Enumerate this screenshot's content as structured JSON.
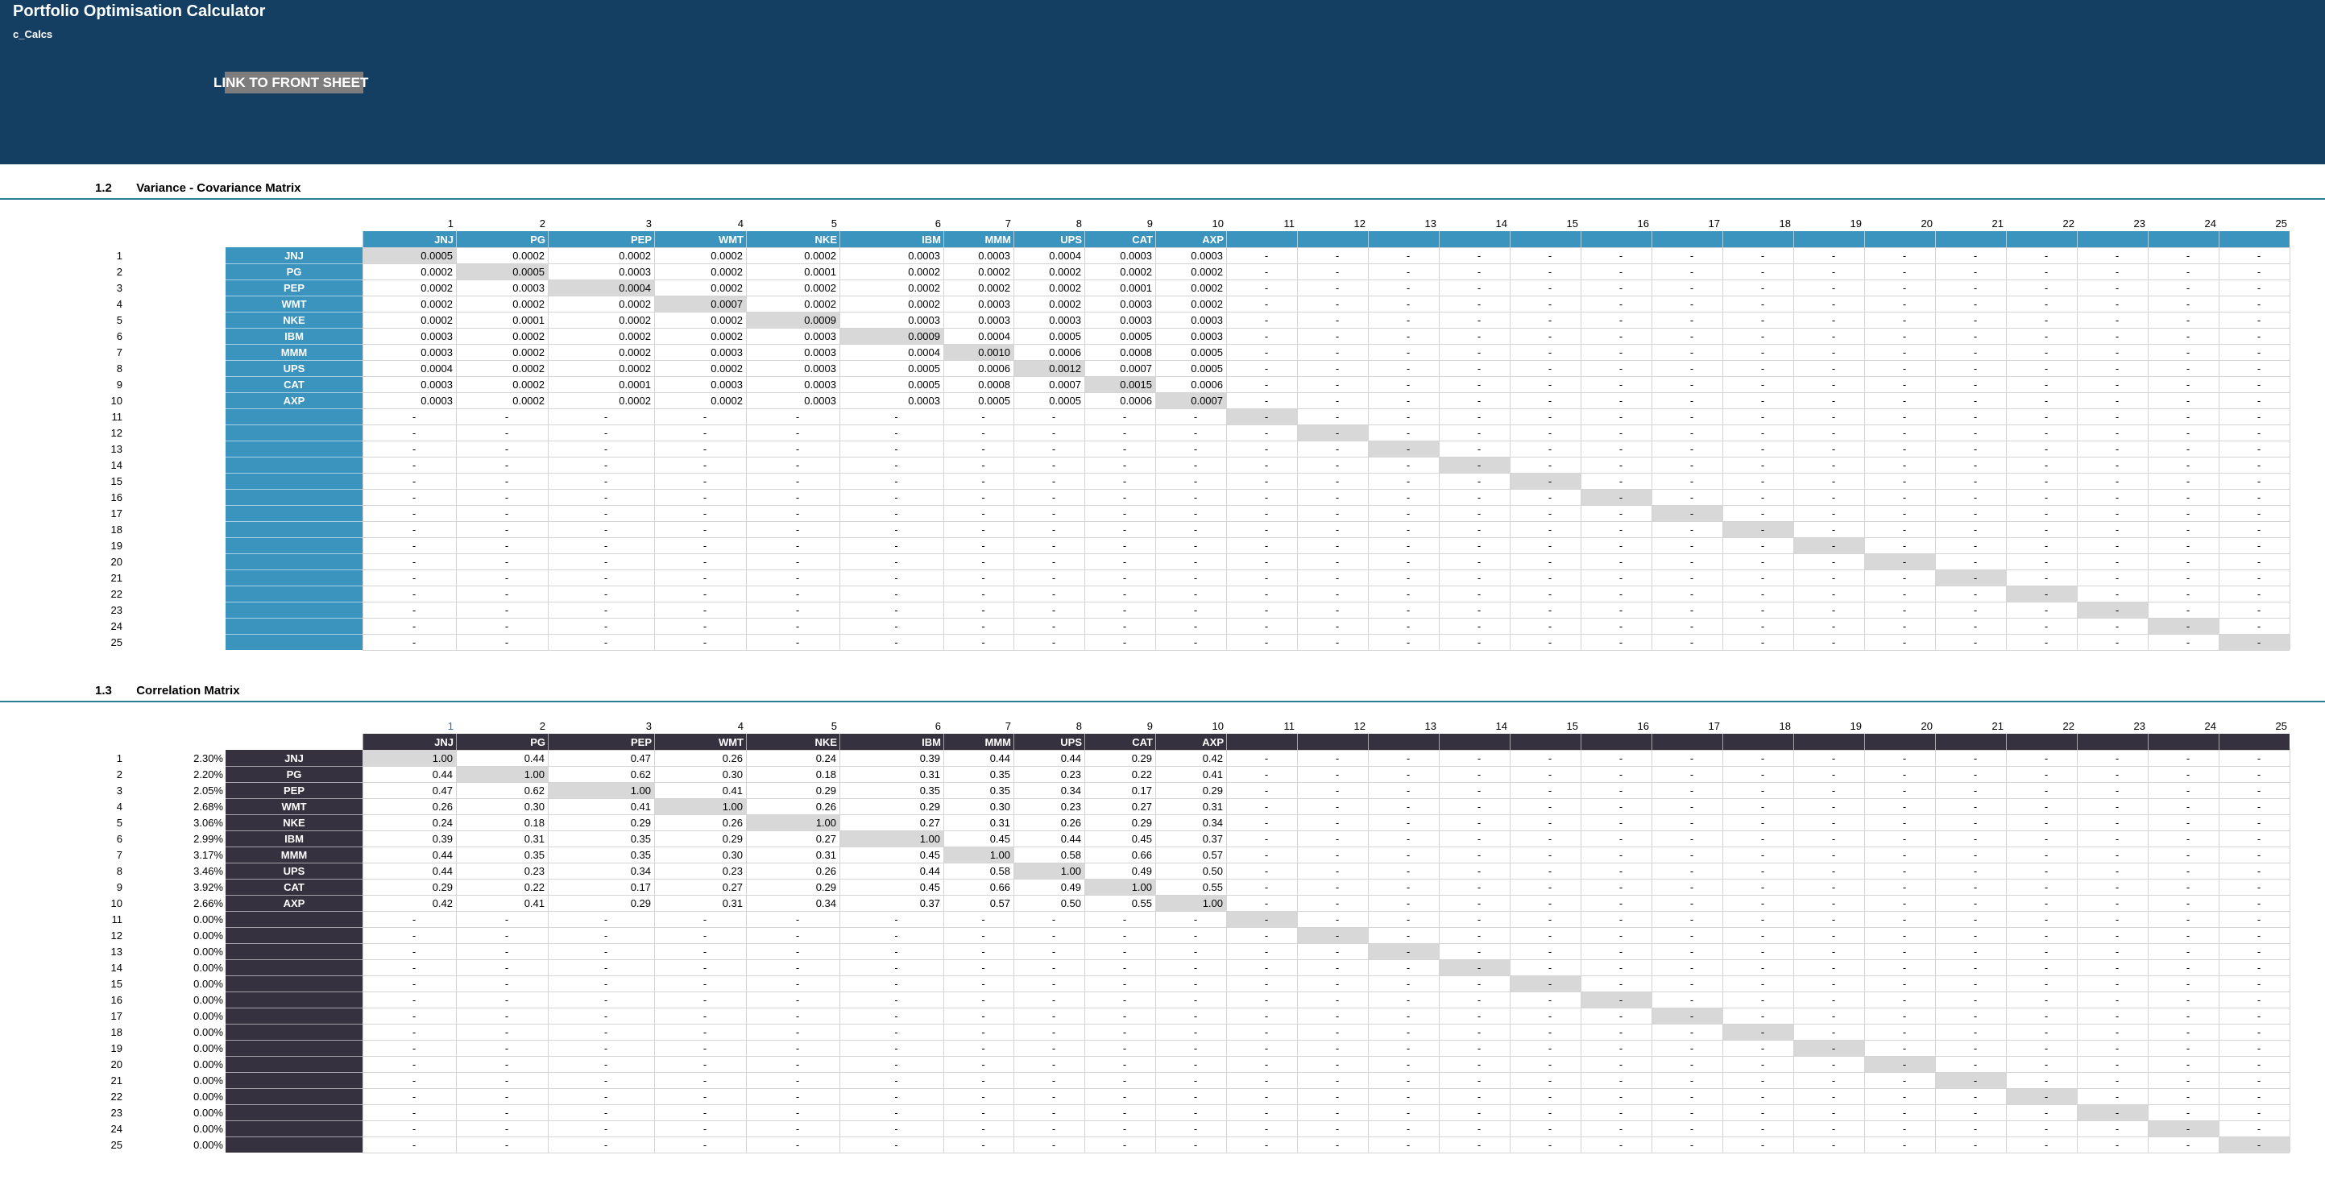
{
  "header": {
    "title": "Portfolio Optimisation Calculator",
    "sheet_name": "c_Calcs",
    "link_label": "LINK TO FRONT SHEET"
  },
  "tickers": [
    "JNJ",
    "PG",
    "PEP",
    "WMT",
    "NKE",
    "IBM",
    "MMM",
    "UPS",
    "CAT",
    "AXP"
  ],
  "covariance": {
    "section_number": "1.2",
    "title": "Variance - Covariance Matrix",
    "label_color": "#3b94be",
    "values": [
      [
        "0.0005",
        "0.0002",
        "0.0002",
        "0.0002",
        "0.0002",
        "0.0003",
        "0.0003",
        "0.0004",
        "0.0003",
        "0.0003"
      ],
      [
        "0.0002",
        "0.0005",
        "0.0003",
        "0.0002",
        "0.0001",
        "0.0002",
        "0.0002",
        "0.0002",
        "0.0002",
        "0.0002"
      ],
      [
        "0.0002",
        "0.0003",
        "0.0004",
        "0.0002",
        "0.0002",
        "0.0002",
        "0.0002",
        "0.0002",
        "0.0001",
        "0.0002"
      ],
      [
        "0.0002",
        "0.0002",
        "0.0002",
        "0.0007",
        "0.0002",
        "0.0002",
        "0.0003",
        "0.0002",
        "0.0003",
        "0.0002"
      ],
      [
        "0.0002",
        "0.0001",
        "0.0002",
        "0.0002",
        "0.0009",
        "0.0003",
        "0.0003",
        "0.0003",
        "0.0003",
        "0.0003"
      ],
      [
        "0.0003",
        "0.0002",
        "0.0002",
        "0.0002",
        "0.0003",
        "0.0009",
        "0.0004",
        "0.0005",
        "0.0005",
        "0.0003"
      ],
      [
        "0.0003",
        "0.0002",
        "0.0002",
        "0.0003",
        "0.0003",
        "0.0004",
        "0.0010",
        "0.0006",
        "0.0008",
        "0.0005"
      ],
      [
        "0.0004",
        "0.0002",
        "0.0002",
        "0.0002",
        "0.0003",
        "0.0005",
        "0.0006",
        "0.0012",
        "0.0007",
        "0.0005"
      ],
      [
        "0.0003",
        "0.0002",
        "0.0001",
        "0.0003",
        "0.0003",
        "0.0005",
        "0.0008",
        "0.0007",
        "0.0015",
        "0.0006"
      ],
      [
        "0.0003",
        "0.0002",
        "0.0002",
        "0.0002",
        "0.0003",
        "0.0003",
        "0.0005",
        "0.0005",
        "0.0006",
        "0.0007"
      ]
    ]
  },
  "correlation": {
    "section_number": "1.3",
    "title": "Correlation Matrix",
    "label_color": "#35313f",
    "weights": [
      "2.30%",
      "2.20%",
      "2.05%",
      "2.68%",
      "3.06%",
      "2.99%",
      "3.17%",
      "3.46%",
      "3.92%",
      "2.66%",
      "0.00%",
      "0.00%",
      "0.00%",
      "0.00%",
      "0.00%",
      "0.00%",
      "0.00%",
      "0.00%",
      "0.00%",
      "0.00%",
      "0.00%",
      "0.00%",
      "0.00%",
      "0.00%",
      "0.00%"
    ],
    "values": [
      [
        "1.00",
        "0.44",
        "0.47",
        "0.26",
        "0.24",
        "0.39",
        "0.44",
        "0.44",
        "0.29",
        "0.42"
      ],
      [
        "0.44",
        "1.00",
        "0.62",
        "0.30",
        "0.18",
        "0.31",
        "0.35",
        "0.23",
        "0.22",
        "0.41"
      ],
      [
        "0.47",
        "0.62",
        "1.00",
        "0.41",
        "0.29",
        "0.35",
        "0.35",
        "0.34",
        "0.17",
        "0.29"
      ],
      [
        "0.26",
        "0.30",
        "0.41",
        "1.00",
        "0.26",
        "0.29",
        "0.30",
        "0.23",
        "0.27",
        "0.31"
      ],
      [
        "0.24",
        "0.18",
        "0.29",
        "0.26",
        "1.00",
        "0.27",
        "0.31",
        "0.26",
        "0.29",
        "0.34"
      ],
      [
        "0.39",
        "0.31",
        "0.35",
        "0.29",
        "0.27",
        "1.00",
        "0.45",
        "0.44",
        "0.45",
        "0.37"
      ],
      [
        "0.44",
        "0.35",
        "0.35",
        "0.30",
        "0.31",
        "0.45",
        "1.00",
        "0.58",
        "0.66",
        "0.57"
      ],
      [
        "0.44",
        "0.23",
        "0.34",
        "0.23",
        "0.26",
        "0.44",
        "0.58",
        "1.00",
        "0.49",
        "0.50"
      ],
      [
        "0.29",
        "0.22",
        "0.17",
        "0.27",
        "0.29",
        "0.45",
        "0.66",
        "0.49",
        "1.00",
        "0.55"
      ],
      [
        "0.42",
        "0.41",
        "0.29",
        "0.31",
        "0.34",
        "0.37",
        "0.57",
        "0.50",
        "0.55",
        "1.00"
      ]
    ]
  },
  "empty_cell": "-",
  "colors": {
    "header_bg": "#143f62",
    "section_line": "#2b7d96",
    "diagonal": "#d8d8d8",
    "grid": "#d4d4d4",
    "first_column_index": "#2e75b6"
  }
}
